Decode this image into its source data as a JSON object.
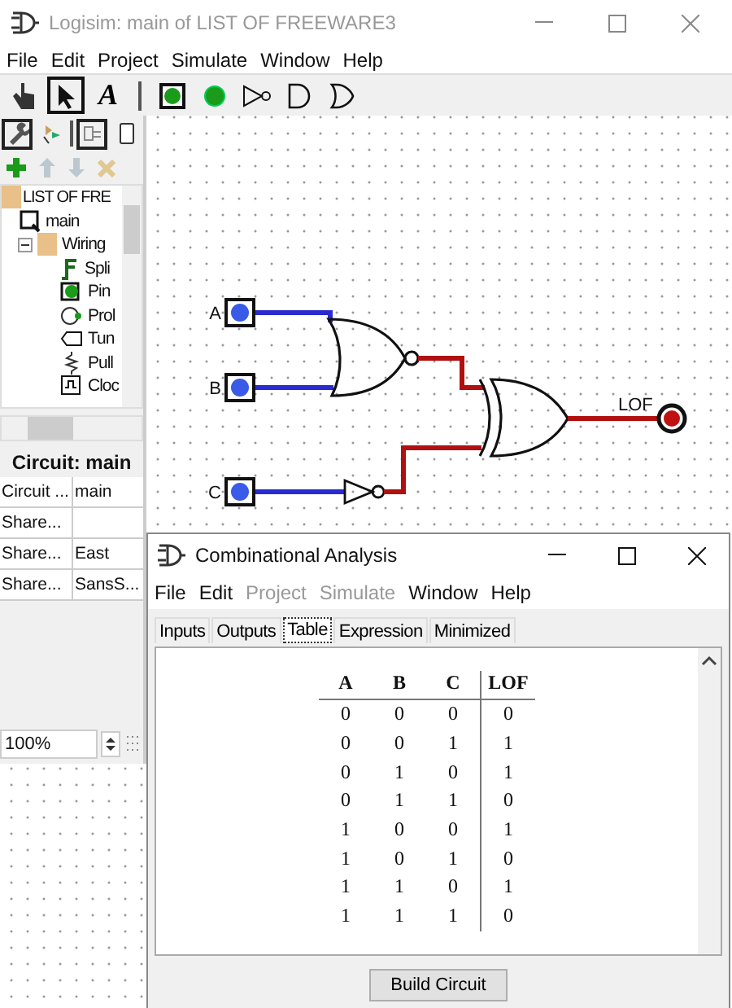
{
  "window": {
    "title": "Logisim: main of LIST OF FREEWARE3"
  },
  "menu": [
    {
      "label": "File"
    },
    {
      "label": "Edit"
    },
    {
      "label": "Project"
    },
    {
      "label": "Simulate"
    },
    {
      "label": "Window"
    },
    {
      "label": "Help"
    }
  ],
  "toolbar": [
    {
      "kind": "poke",
      "selected": false
    },
    {
      "kind": "select",
      "selected": true
    },
    {
      "kind": "text",
      "label": "A",
      "selected": false
    },
    {
      "kind": "input-pin",
      "selected": false
    },
    {
      "kind": "output-pin",
      "selected": false
    },
    {
      "kind": "not-gate",
      "selected": false
    },
    {
      "kind": "and-gate",
      "selected": false
    },
    {
      "kind": "or-gate",
      "selected": false
    }
  ],
  "explorer_toolbar": [
    {
      "kind": "wrench",
      "selected": true
    },
    {
      "kind": "hierarchy",
      "selected": false
    },
    {
      "kind": "layout",
      "selected": true
    },
    {
      "kind": "appearance",
      "selected": false
    }
  ],
  "project_actions": [
    {
      "kind": "add",
      "disabled": false
    },
    {
      "kind": "up",
      "disabled": true
    },
    {
      "kind": "down",
      "disabled": true
    },
    {
      "kind": "delete",
      "disabled": true
    }
  ],
  "tree": {
    "label": "LIST OF FRE",
    "children": [
      {
        "label": "main",
        "kind": "circuit"
      },
      {
        "label": "Wiring",
        "kind": "folder",
        "expanded": true,
        "children": [
          {
            "label": "Spli",
            "kind": "splitter"
          },
          {
            "label": "Pin",
            "kind": "pin"
          },
          {
            "label": "Prol",
            "kind": "probe"
          },
          {
            "label": "Tun",
            "kind": "tunnel"
          },
          {
            "label": "Pull",
            "kind": "pull"
          },
          {
            "label": "Cloc",
            "kind": "clock"
          }
        ]
      }
    ]
  },
  "attributes": {
    "title": "Circuit: main",
    "rows": [
      {
        "name": "Circuit ...",
        "value": "main"
      },
      {
        "name": "Share..."
      },
      {
        "name": "Share...",
        "value": "East"
      },
      {
        "name": "Share...",
        "value": "SansS..."
      }
    ]
  },
  "zoom": {
    "value": "100%"
  },
  "circuit": {
    "inputs": [
      {
        "label": "A"
      },
      {
        "label": "B"
      },
      {
        "label": "C"
      }
    ],
    "output": {
      "label": "LOF"
    }
  },
  "dialog": {
    "title": "Combinational Analysis",
    "menu": [
      {
        "label": "File",
        "disabled": false
      },
      {
        "label": "Edit",
        "disabled": false
      },
      {
        "label": "Project",
        "disabled": true
      },
      {
        "label": "Simulate",
        "disabled": true
      },
      {
        "label": "Window",
        "disabled": false
      },
      {
        "label": "Help",
        "disabled": false
      }
    ],
    "tabs": [
      {
        "label": "Inputs",
        "selected": false
      },
      {
        "label": "Outputs",
        "selected": false
      },
      {
        "label": "Table",
        "selected": true
      },
      {
        "label": "Expression",
        "selected": false
      },
      {
        "label": "Minimized",
        "selected": false
      }
    ],
    "table": {
      "columns": [
        "A",
        "B",
        "C",
        "LOF"
      ],
      "rows": [
        [
          "0",
          "0",
          "0",
          "0"
        ],
        [
          "0",
          "0",
          "1",
          "1"
        ],
        [
          "0",
          "1",
          "0",
          "1"
        ],
        [
          "0",
          "1",
          "1",
          "0"
        ],
        [
          "1",
          "0",
          "0",
          "1"
        ],
        [
          "1",
          "0",
          "1",
          "0"
        ],
        [
          "1",
          "1",
          "0",
          "1"
        ],
        [
          "1",
          "1",
          "1",
          "0"
        ]
      ]
    },
    "button": "Build Circuit"
  }
}
